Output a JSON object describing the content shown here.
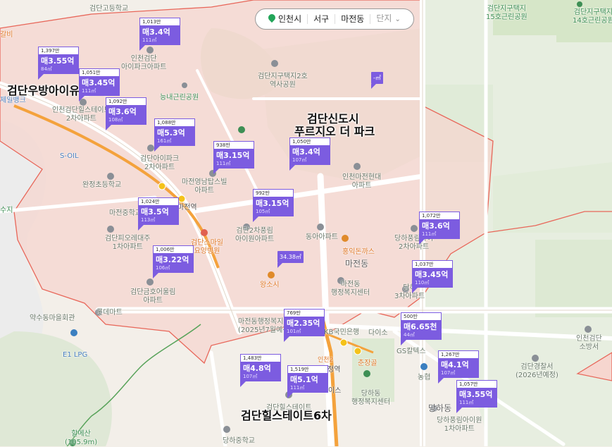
{
  "breadcrumb": {
    "city": "인천시",
    "district": "서구",
    "neighborhood": "마전동",
    "complex_select": "단지"
  },
  "complex_titles": [
    {
      "text": "검단우방아이유쉘2차"
    },
    {
      "text": "검단신도시"
    },
    {
      "text": "푸르지오 더 파크"
    },
    {
      "text": "검단힐스테이트6차"
    }
  ],
  "price_markers": [
    {
      "count": "1,013만",
      "price": "매3.4억",
      "size": "111㎡"
    },
    {
      "count": "1,397만",
      "price": "매3.55억",
      "size": "84㎡"
    },
    {
      "count": "1,051만",
      "price": "매3.45억",
      "size": "111㎡"
    },
    {
      "count": "1,092만",
      "price": "매3.6억",
      "size": "108㎡"
    },
    {
      "count": "1,088만",
      "price": "매5.3억",
      "size": "161㎡"
    },
    {
      "count": "938만",
      "price": "매3.15억",
      "size": "111㎡"
    },
    {
      "count": "1,050만",
      "price": "매3.4억",
      "size": "107㎡"
    },
    {
      "count": "992만",
      "price": "매3.15억",
      "size": "105㎡"
    },
    {
      "count": "1,024만",
      "price": "매3.5억",
      "size": "113㎡"
    },
    {
      "count": "1,006만",
      "price": "매3.22억",
      "size": "106㎡"
    },
    {
      "count": "1,072만",
      "price": "매3.6억",
      "size": "111㎡"
    },
    {
      "count": "1,037만",
      "price": "매3.45억",
      "size": "110㎡"
    },
    {
      "count": "769만",
      "price": "매2.35억",
      "size": "101㎡"
    },
    {
      "count": "500만",
      "price": "매6.65천",
      "size": "44㎡"
    },
    {
      "count": "1,483만",
      "price": "매4.8억",
      "size": "107㎡"
    },
    {
      "count": "1,519만",
      "price": "매5.1억",
      "size": "111㎡"
    },
    {
      "count": "1,267만",
      "price": "매4.1억",
      "size": "107㎡"
    },
    {
      "count": "1,057만",
      "price": "매3.55억",
      "size": "111㎡"
    }
  ],
  "small_markers": [
    {
      "text": "-㎡"
    },
    {
      "text": "34.38㎡"
    }
  ],
  "place_labels": [
    {
      "text": "검단고등학교"
    },
    {
      "text": "인천검단\n아이파크아파트"
    },
    {
      "text": "검단지구택지2호\n역사공원"
    },
    {
      "text": "능내근린공원"
    },
    {
      "text": "인천검단힐스테이트\n2차아파트"
    },
    {
      "text": "S-OIL"
    },
    {
      "text": "검단아이파크\n2차아파트"
    },
    {
      "text": "마전영남탑스빌\n아파트"
    },
    {
      "text": "완정초등학교"
    },
    {
      "text": "마전중학교"
    },
    {
      "text": "검단피오레대주\n1차아파트"
    },
    {
      "text": "검단스마일\n요양병원"
    },
    {
      "text": "검단2차풍림\n아이원아파트"
    },
    {
      "text": "동아아파트"
    },
    {
      "text": "인천마전현대\n아파트"
    },
    {
      "text": "홍익돈까스"
    },
    {
      "text": "마전동"
    },
    {
      "text": "마전동\n행정복지센터"
    },
    {
      "text": "검단금호어울림\n아파트"
    },
    {
      "text": "롯데마트"
    },
    {
      "text": "왕소시"
    },
    {
      "text": "약수동마을회관"
    },
    {
      "text": "E1 LPG"
    },
    {
      "text": "마전동행정복지센터\n(2025년7월예정)"
    },
    {
      "text": "KB국민은행"
    },
    {
      "text": "다이소"
    },
    {
      "text": "GS칼텍스"
    },
    {
      "text": "춘장골"
    },
    {
      "text": "당하동\n행정복지센터"
    },
    {
      "text": "농협"
    },
    {
      "text": "검단경찰서\n(2026년예정)"
    },
    {
      "text": "인천검단\n소방서"
    },
    {
      "text": "당하동"
    },
    {
      "text": "당하풍림아이원\n1차아파트"
    },
    {
      "text": "당하중학교"
    },
    {
      "text": "할메산\n(105.9m)"
    },
    {
      "text": "검단지구택지\n15호근린공원"
    },
    {
      "text": "검단지구택지\n14호근린공원"
    },
    {
      "text": "당하풍림아이\n2차아파트"
    },
    {
      "text": "당하\n3차아파트"
    },
    {
      "text": "검단힐스테이트"
    },
    {
      "text": "갈비"
    },
    {
      "text": "제일뱅크"
    },
    {
      "text": "수지"
    },
    {
      "text": "마전역"
    },
    {
      "text": "정역"
    },
    {
      "text": "이스"
    },
    {
      "text": "인천2"
    }
  ],
  "colors": {
    "accent": "#7c5ce0",
    "district_boundary": "#e8675a",
    "district_fill": "#f7d3cb",
    "park": "#d7e6c9",
    "road": "#ffffff",
    "subway_line": "#f4a23c"
  }
}
